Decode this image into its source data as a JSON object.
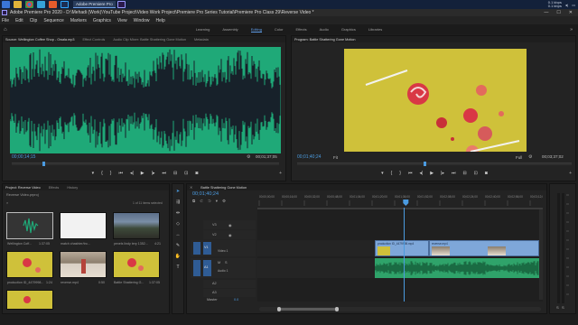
{
  "taskbar": {
    "task_label": "Adobe Premiere Pro",
    "tray_speed_up": "0.1 kbps",
    "tray_speed_down": "0.1 kbps",
    "tray_time": "",
    "colors": {
      "bg": "#13213a"
    }
  },
  "window": {
    "title": "Adobe Premiere Pro 2020 - D:\\Mehadi (Work)\\YouTube Project\\Video Work Project\\Premiere Pro Series Tutorial\\Premiere Pro Class 29\\Reverse Video *"
  },
  "menu": [
    "File",
    "Edit",
    "Clip",
    "Sequence",
    "Markers",
    "Graphics",
    "View",
    "Window",
    "Help"
  ],
  "workspaces": {
    "items": [
      "Learning",
      "Assembly",
      "Editing",
      "Color",
      "Effects",
      "Audio",
      "Graphics",
      "Libraries"
    ],
    "active": "Editing"
  },
  "source_panel": {
    "tabs": [
      "Source: Wellington Coffee Shop - Owala.mp3",
      "Effect Controls",
      "Audio Clip Mixer: Battle Shattering Gone Motion",
      "Metadata"
    ],
    "timecode_left": "00;00;14;15",
    "timecode_right": "00;01;37;05",
    "waveform_color": "#1fa978"
  },
  "program_panel": {
    "tab": "Program: Battle Shattering Gone Motion",
    "timecode_left": "00;01;40;24",
    "fit": "Fit",
    "quality": "Full",
    "timecode_right": "00;03;37;02"
  },
  "project_panel": {
    "tabs": [
      "Project: Reverse Video",
      "Effects",
      "History"
    ],
    "project_name": "Reverse Video.prproj",
    "item_count": "1 of 11 items selected",
    "items": [
      {
        "name": "Wellington Coff...",
        "duration": "1:37:05"
      },
      {
        "name": "match chashter/tro...",
        "duration": ""
      },
      {
        "name": "pexels lindy tery 1352...",
        "duration": "4:21"
      },
      {
        "name": "production ID_4479998...",
        "duration": "1:24"
      },
      {
        "name": "reverse.mp4",
        "duration": "0:50"
      },
      {
        "name": "Battle Shattering G...",
        "duration": "1:37:05"
      }
    ]
  },
  "timeline": {
    "tab": "Battle Shattering Gone Motion",
    "timecode": "00;01;40;24",
    "ruler": [
      "00;00;00;00",
      "00;00;16;00",
      "00;00;32;00",
      "00;00;48;00",
      "00;01;04;00",
      "00;01;20;00",
      "00;01;36;00",
      "00;01;52;00",
      "00;02;08;00",
      "00;02;24;00",
      "00;02;40;00",
      "00;02;56;00",
      "00;03;12;00"
    ],
    "tracks_video": [
      "V3",
      "V2",
      "V1"
    ],
    "tracks_audio": [
      "A1",
      "A2",
      "A3"
    ],
    "video_label": "Video 1",
    "audio_label": "Audio 1",
    "master_label": "Master",
    "master_value": "0.0",
    "clips": [
      "production ID_4479998.mp4",
      "reverse.mp4"
    ],
    "playhead_fraction": 0.52
  },
  "colors": {
    "accent_blue": "#4b9be0",
    "audio_green": "#2fa36a",
    "video_blue": "#7ea7d9",
    "program_bg": "#cfc13a"
  }
}
